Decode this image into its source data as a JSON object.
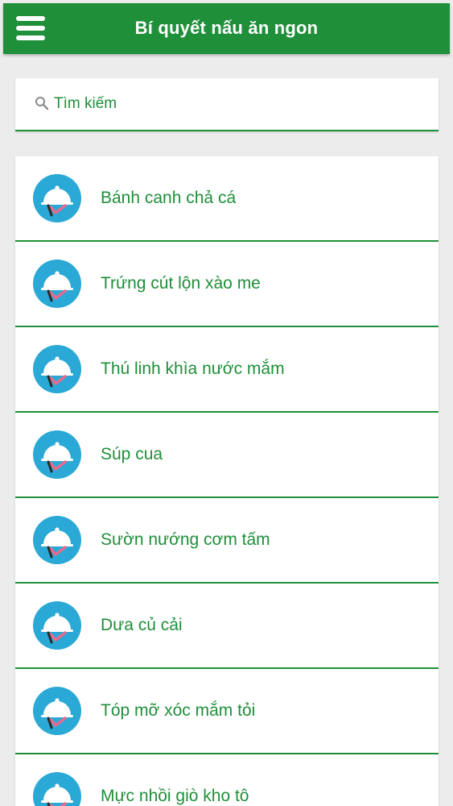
{
  "header": {
    "title": "Bí quyết nấu ăn ngon"
  },
  "search": {
    "placeholder": "Tìm kiếm"
  },
  "colors": {
    "primary": "#1f8f3a",
    "icon_bg": "#2aa9d6"
  },
  "items": [
    {
      "label": "Bánh canh chả cá",
      "icon": "serving-dish-icon"
    },
    {
      "label": "Trứng cút lộn xào me",
      "icon": "serving-dish-icon"
    },
    {
      "label": "Thú linh khìa nước mắm",
      "icon": "serving-dish-icon"
    },
    {
      "label": "Súp cua",
      "icon": "serving-dish-icon"
    },
    {
      "label": "Sườn nướng cơm tấm",
      "icon": "serving-dish-icon"
    },
    {
      "label": "Dưa củ cải",
      "icon": "serving-dish-icon"
    },
    {
      "label": "Tóp mỡ xóc mắm tỏi",
      "icon": "serving-dish-icon"
    },
    {
      "label": "Mực nhồi giò kho tô",
      "icon": "serving-dish-icon"
    }
  ]
}
